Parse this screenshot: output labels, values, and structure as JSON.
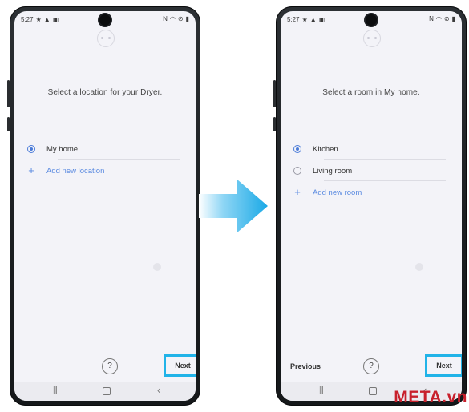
{
  "status_bar": {
    "time": "5:27",
    "left_icons": [
      "★",
      "▲",
      "▣"
    ],
    "right_icons": [
      "N",
      "◠",
      "⊘",
      "▮"
    ]
  },
  "left_screen": {
    "title": "Select a location for your Dryer.",
    "options": [
      {
        "label": "My home",
        "selected": true
      }
    ],
    "add_label": "Add new location",
    "help_label": "?",
    "next_label": "Next"
  },
  "right_screen": {
    "title": "Select a room in My home.",
    "options": [
      {
        "label": "Kitchen",
        "selected": true
      },
      {
        "label": "Living room",
        "selected": false
      }
    ],
    "add_label": "Add new room",
    "previous_label": "Previous",
    "help_label": "?",
    "next_label": "Next"
  },
  "nav_bar": {
    "recent_icon": "recent-apps-icon",
    "home_icon": "home-icon",
    "back_icon": "back-icon",
    "recent_glyph": "|||",
    "back_glyph": "‹"
  },
  "colors": {
    "accent": "#4a7bd8",
    "highlight_border": "#21b3e8",
    "arrow": "#1aa9e6",
    "watermark": "#c8202c"
  },
  "watermark": "META.vn"
}
